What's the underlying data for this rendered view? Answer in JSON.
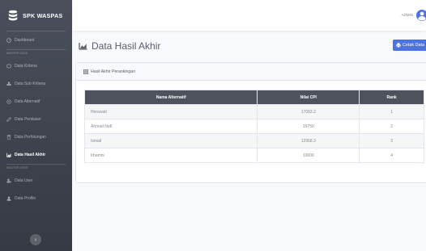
{
  "app": {
    "brand": "SPK WASPAS"
  },
  "sidebar": {
    "items": [
      {
        "label": "Dashboard",
        "icon": "dashboard-icon"
      },
      {
        "label": "MASTER DATA",
        "heading": true
      },
      {
        "label": "Data Kriteria",
        "icon": "cube-icon"
      },
      {
        "label": "Data Sub Kriteria",
        "icon": "cubes-icon"
      },
      {
        "label": "Data Alternatif",
        "icon": "users-icon"
      },
      {
        "label": "Data Penilaian",
        "icon": "edit-icon"
      },
      {
        "label": "Data Perhitungan",
        "icon": "calculator-icon"
      },
      {
        "label": "Data Hasil Akhir",
        "icon": "chart-area-icon",
        "active": true
      },
      {
        "label": "MASTER USER",
        "heading": true
      },
      {
        "label": "Data User",
        "icon": "user-cog-icon"
      },
      {
        "label": "Data Profile",
        "icon": "user-icon"
      }
    ]
  },
  "topbar": {
    "user_name": "ADMIN"
  },
  "page": {
    "title": "Data Hasil Akhir",
    "print_label": "Cetak Data"
  },
  "card": {
    "title": "Hasil Akhir Perankingan",
    "columns": [
      "Nama Alternatif",
      "Nilai CPI",
      "Rank"
    ],
    "rows": [
      {
        "name": "Herawati",
        "score": "17083.3",
        "rank": "1"
      },
      {
        "name": "Ahmad Nafi",
        "score": "15750",
        "rank": "2"
      },
      {
        "name": "Ismail",
        "score": "12958.3",
        "rank": "3"
      },
      {
        "name": "Irhamni",
        "score": "10000",
        "rank": "4"
      }
    ]
  },
  "colors": {
    "primary": "#4e73df",
    "sidebar": "#3d424c",
    "table_header": "#4d525c"
  }
}
